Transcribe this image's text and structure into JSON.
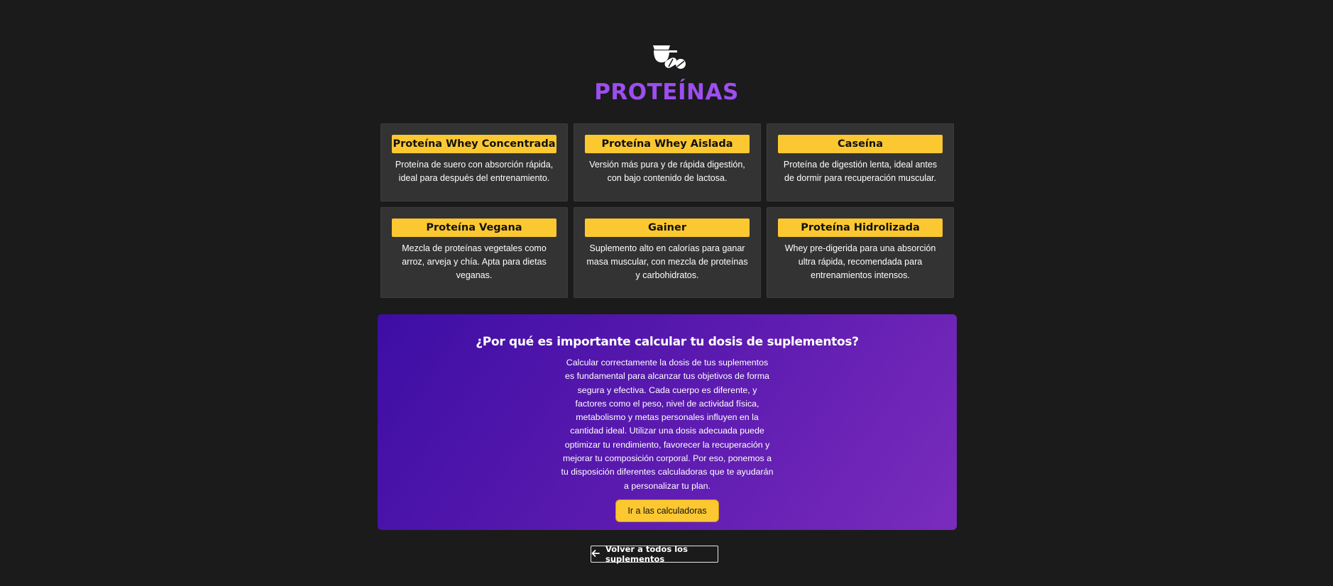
{
  "header": {
    "icon": "supplements-scoop-pills-icon",
    "title": "PROTEÍNAS"
  },
  "cards": [
    {
      "title": "Proteína Whey Concentrada",
      "description": "Proteína de suero con absorción rápida, ideal para después del entrenamiento."
    },
    {
      "title": "Proteína Whey Aislada",
      "description": "Versión más pura y de rápida digestión, con bajo contenido de lactosa."
    },
    {
      "title": "Caseína",
      "description": "Proteína de digestión lenta, ideal antes de dormir para recuperación muscular."
    },
    {
      "title": "Proteína Vegana",
      "description": "Mezcla de proteínas vegetales como arroz, arveja y chía. Apta para dietas veganas."
    },
    {
      "title": "Gainer",
      "description": "Suplemento alto en calorías para ganar masa muscular, con mezcla de proteínas y carbohidratos."
    },
    {
      "title": "Proteína Hidrolizada",
      "description": "Whey pre-digerida para una absorción ultra rápida, recomendada para entrenamientos intensos."
    }
  ],
  "cta": {
    "title": "¿Por qué es importante calcular tu dosis de suplementos?",
    "text": "Calcular correctamente la dosis de tus suplementos es fundamental para alcanzar tus objetivos de forma segura y efectiva. Cada cuerpo es diferente, y factores como el peso, nivel de actividad física, metabolismo y metas personales influyen en la cantidad ideal. Utilizar una dosis adecuada puede optimizar tu rendimiento, favorecer la recuperación y mejorar tu composición corporal. Por eso, ponemos a tu disposición diferentes calculadoras que te ayudarán a personalizar tu plan.",
    "button_label": "Ir a las calculadoras"
  },
  "back_button": {
    "icon": "arrow-left-icon",
    "label": "Volver a todos los suplementos"
  },
  "colors": {
    "background": "#1b1b1b",
    "title": "#9d4ef0",
    "card_bg": "#333333",
    "card_title_bg": "#fcc832",
    "cta_gradient_start": "#3d0ea4",
    "cta_gradient_end": "#7a2cbd"
  }
}
